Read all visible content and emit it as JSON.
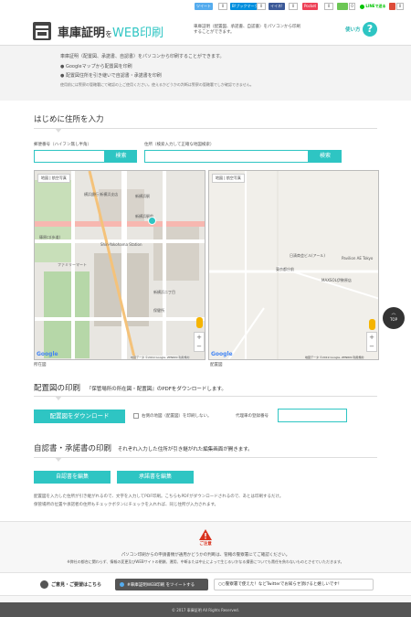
{
  "share": {
    "tweet": "ツイート",
    "tweet_count": "0",
    "hatena": "B!ブックマーク",
    "hatena_count": "0",
    "like": "イイネ!",
    "like_count": "0",
    "pocket": "Pocket",
    "pocket_count": "0",
    "feedly_count": "0",
    "line": "LINEで送る",
    "gplus_count": "0"
  },
  "header": {
    "title_part1": "車庫証明",
    "title_wo": "を",
    "title_part2": "WEB印刷",
    "tagline": "車庫証明（配置図、承諾書、自認書）をパソコンから印刷することができます。",
    "howto": "使い方",
    "help": "?"
  },
  "intro": {
    "line1": "車庫証明（配置図、承諾書、自認書）をパソコンから印刷することができます。",
    "line2": "● Googleマップから配置図を印刷",
    "line3": "● 配置図住所を引き継いで自認書・承諾書を印刷",
    "line4": "使用前には警察の管轄署にて確認の上ご使用ください。使えるかどうかの判断は警察の管轄署でしか確認できません。"
  },
  "address": {
    "section_title": "はじめに住所を入力",
    "zip_label": "郵便番号（ハイフン無し半角）",
    "zip_value": "",
    "search_label": "検索",
    "addr_label": "住所（検索入力して正確な地図検索）",
    "addr_value": "",
    "search_label2": "検索",
    "map1_caption": "所在図",
    "map2_caption": "配置図",
    "map_btn": "地図",
    "sat_btn": "航空写真",
    "map1_places": [
      "横浜銀行 新横浜支店",
      "新横浜駅",
      "Shin-Yokohama Station",
      "篠原口(歩道)",
      "新横浜二丁目",
      "ファミリーマート",
      "保健所",
      "新横浜駅前",
      "Google"
    ],
    "map2_places": [
      "日清商会ビル(アール)",
      "Pavilion AE Tokyo",
      "東京都庁前",
      "MAXSOL伊勢原店",
      "Google"
    ],
    "map_footer1": "地図データ ©2019 Google, ZENRIN 利用規約",
    "map_footer2": "地図データ ©2019 Google, ZENRIN 利用規約"
  },
  "layout": {
    "section_title": "配置図の印刷",
    "section_sub": "『保管場所の所在図・配置図』のPDFをダウンロードします。",
    "download_btn": "配置図をダウンロード",
    "checkbox_label": "右側の地図（配置図）を印刷しない。",
    "number_label": "代理車の登録番号",
    "number_value": ""
  },
  "docs": {
    "section_title": "自認書・承諾書の印刷",
    "section_sub": "それぞれ入力した住所が引き継がれた編集画面が開きます。",
    "edit_self_btn": "自認書を編集",
    "edit_consent_btn": "承諾書を編集",
    "note1": "配置図を入力した住所が引き継がれるので、文字を入力してPDF印刷。こちらもPDFがダウンロードされるので、あとは印刷するだけ。",
    "note2": "保管場所の位置や承諾者の住所もチェックボタンにチェックを入れれば、同じ住所が入力されます。"
  },
  "caution": {
    "title": "ご注意",
    "line1": "パソコン印刷からの申請書類が通用かどうかの判断は、管轄の警察署にてご確認ください。",
    "line2": "※弊社の都合に関わらず、情報の変更及びWEBサイトの閉鎖、運用、中断または中止によって生じるいかなる損害についても責任を負わないものとさせていただきます。"
  },
  "bottom": {
    "contact": "ご意見・ご要望はこちら",
    "tweet_btn": "#車庫証明WEB印刷 をツイートする",
    "tweet_prompt": "○○警察署で使えた！などTwitterでお知らせ頂けると嬉しいです！",
    "copyright": "© 2017 車庫証明 All Rights Reserved.",
    "top_btn": "TOP"
  },
  "colors": {
    "accent": "#2ec5c3",
    "twitter": "#55acee",
    "hatena": "#008fde",
    "facebook": "#3b5998",
    "pocket": "#ee4056",
    "line": "#00c300"
  }
}
